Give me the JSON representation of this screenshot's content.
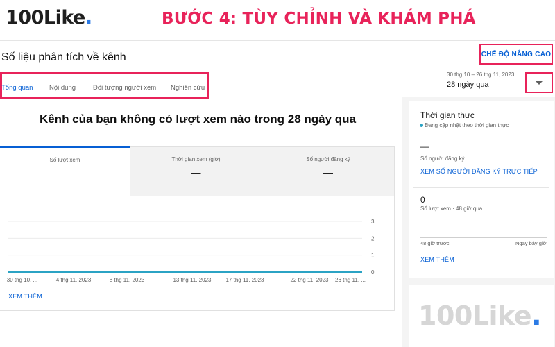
{
  "logo": {
    "text": "100Like",
    "dot": "."
  },
  "banner": {
    "text": "BƯỚC 4: TÙY CHỈNH VÀ KHÁM PHÁ"
  },
  "page": {
    "title": "Số liệu phân tích về kênh"
  },
  "advanced_mode": {
    "label": "CHẾ ĐỘ NÂNG CAO"
  },
  "date_picker": {
    "range": "30 thg 10 – 26 thg 11, 2023",
    "period": "28 ngày qua"
  },
  "tabs": [
    {
      "label": "Tổng quan",
      "active": true
    },
    {
      "label": "Nội dung",
      "active": false
    },
    {
      "label": "Đối tượng người xem",
      "active": false
    },
    {
      "label": "Nghiên cứu",
      "active": false
    }
  ],
  "overview": {
    "headline": "Kênh của bạn không có lượt xem nào trong 28 ngày qua",
    "metrics": [
      {
        "label": "Số lượt xem",
        "value": "—",
        "selected": true
      },
      {
        "label": "Thời gian xem (giờ)",
        "value": "—",
        "selected": false
      },
      {
        "label": "Số người đăng ký",
        "value": "—",
        "selected": false
      }
    ],
    "see_more": "XEM THÊM"
  },
  "chart_data": {
    "type": "line",
    "x_tick_labels": [
      "30 thg 10, ...",
      "4 thg 11, 2023",
      "8 thg 11, 2023",
      "13 thg 11, 2023",
      "17 thg 11, 2023",
      "22 thg 11, 2023",
      "26 thg 11, ..."
    ],
    "y_ticks": [
      0,
      1,
      2,
      3
    ],
    "ylim": [
      0,
      3
    ],
    "series": [
      {
        "values": [
          0,
          0,
          0,
          0,
          0,
          0,
          0
        ]
      }
    ],
    "grid": true,
    "line_color": "#2ba3c4"
  },
  "realtime": {
    "title": "Thời gian thực",
    "status": "Đang cập nhật theo thời gian thực",
    "subscribers_value": "—",
    "subscribers_label": "Số người đăng ký",
    "subscribers_link": "XEM SỐ NGƯỜI ĐĂNG KÝ TRỰC TIẾP",
    "views_value": "0",
    "views_label": "Số lượt xem · 48 giờ qua",
    "axis_left": "48 giờ trước",
    "axis_right": "Ngay bây giờ",
    "see_more": "XEM THÊM"
  },
  "colors": {
    "accent": "#065fd4",
    "highlight": "#e8235a",
    "live": "#2ba3c4"
  },
  "icons": {
    "dropdown": "caret-down-icon",
    "live_status": "live-dot-icon"
  }
}
